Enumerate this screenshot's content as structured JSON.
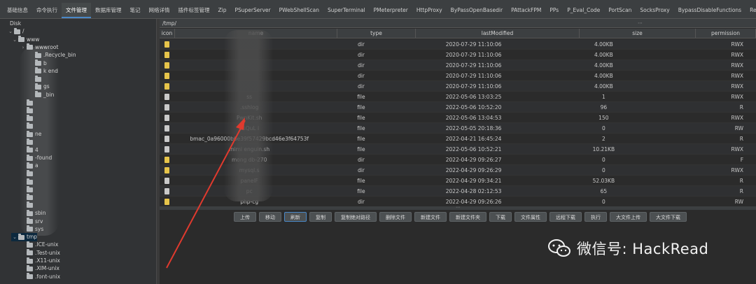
{
  "tabs": [
    "基础信息",
    "命令执行",
    "文件管理",
    "数据库管理",
    "笔记",
    "网络详情",
    "插件标签管理",
    "Zip",
    "PSuperServer",
    "PWebShellScan",
    "SuperTerminal",
    "PMeterpreter",
    "HttpProxy",
    "ByPassOpenBasedir",
    "PAttackFPM",
    "PPs",
    "P_Eval_Code",
    "PortScan",
    "SocksProxy",
    "BypassDisableFunctions",
    "ReaR"
  ],
  "active_tab_index": 2,
  "tree": {
    "rows": [
      {
        "label": "Disk",
        "caret": "",
        "folder": false
      },
      {
        "label": "/",
        "caret": "⌄",
        "folder": true
      },
      {
        "label": "www",
        "caret": "⌄",
        "folder": true
      },
      {
        "label": "wwwroot",
        "caret": "›",
        "folder": true
      },
      {
        "label": ".Recycle_bin",
        "caret": "",
        "folder": true
      },
      {
        "label": "b",
        "caret": "",
        "folder": true
      },
      {
        "label": "k      end",
        "caret": "",
        "folder": true
      },
      {
        "label": "",
        "caret": "",
        "folder": true
      },
      {
        "label": "      gs",
        "caret": "",
        "folder": true
      },
      {
        "label": "       _bin",
        "caret": "",
        "folder": true
      },
      {
        "label": "",
        "caret": "",
        "folder": true
      },
      {
        "label": "",
        "caret": "",
        "folder": true
      },
      {
        "label": "",
        "caret": "",
        "folder": true
      },
      {
        "label": "",
        "caret": "",
        "folder": true
      },
      {
        "label": "      ne",
        "caret": "",
        "folder": true
      },
      {
        "label": "",
        "caret": "",
        "folder": true
      },
      {
        "label": "      4",
        "caret": "",
        "folder": true
      },
      {
        "label": "      -found",
        "caret": "",
        "folder": true
      },
      {
        "label": "      a",
        "caret": "",
        "folder": true
      },
      {
        "label": "",
        "caret": "",
        "folder": true
      },
      {
        "label": "",
        "caret": "",
        "folder": true
      },
      {
        "label": "",
        "caret": "",
        "folder": true
      },
      {
        "label": "",
        "caret": "",
        "folder": true
      },
      {
        "label": "",
        "caret": "",
        "folder": true
      },
      {
        "label": "sbin",
        "caret": "",
        "folder": true
      },
      {
        "label": "srv",
        "caret": "",
        "folder": true
      },
      {
        "label": "sys",
        "caret": "",
        "folder": true
      },
      {
        "label": "tmp",
        "caret": "⌄",
        "folder": true
      },
      {
        "label": ".ICE-unix",
        "caret": "",
        "folder": true
      },
      {
        "label": ".Test-unix",
        "caret": "",
        "folder": true
      },
      {
        "label": ".X11-unix",
        "caret": "",
        "folder": true
      },
      {
        "label": ".XIM-unix",
        "caret": "",
        "folder": true
      },
      {
        "label": ".font-unix",
        "caret": "",
        "folder": true
      }
    ]
  },
  "path": "/tmp/",
  "columns": [
    "icon",
    "name",
    "type",
    "lastModified",
    "size",
    "permission"
  ],
  "files": [
    {
      "kind": "dir",
      "name": "",
      "type": "dir",
      "lastModified": "2020-07-29 11:10:06",
      "size": "4.00KB",
      "permission": "RWX"
    },
    {
      "kind": "dir",
      "name": "",
      "type": "dir",
      "lastModified": "2020-07-29 11:10:06",
      "size": "4.00KB",
      "permission": "RWX"
    },
    {
      "kind": "dir",
      "name": "",
      "type": "dir",
      "lastModified": "2020-07-29 11:10:06",
      "size": "4.00KB",
      "permission": "RWX"
    },
    {
      "kind": "dir",
      "name": "",
      "type": "dir",
      "lastModified": "2020-07-29 11:10:06",
      "size": "4.00KB",
      "permission": "RWX"
    },
    {
      "kind": "dir",
      "name": "",
      "type": "dir",
      "lastModified": "2020-07-29 11:10:06",
      "size": "4.00KB",
      "permission": "RWX"
    },
    {
      "kind": "file",
      "name": "          ss",
      "type": "file",
      "lastModified": "2022-05-06 13:03:25",
      "size": "1",
      "permission": "RWX"
    },
    {
      "kind": "file",
      "name": ".sshlog",
      "type": "file",
      "lastModified": "2022-05-06 10:52:20",
      "size": "96",
      "permission": "R"
    },
    {
      "kind": "file",
      "name": "PwnKit.sh",
      "type": "file",
      "lastModified": "2022-05-06 13:04:53",
      "size": "150",
      "permission": "RWX"
    },
    {
      "kind": "file",
      "name": "asQuL  i",
      "type": "file",
      "lastModified": "2022-05-05 20:18:36",
      "size": "0",
      "permission": "RW"
    },
    {
      "kind": "file",
      "name": "bmac_0a96000b6e39f57429bcd46e3f64753f",
      "type": "file",
      "lastModified": "2022-04-21 16:45:24",
      "size": "2",
      "permission": "R"
    },
    {
      "kind": "file",
      "name": "mimi  enguin.sh",
      "type": "file",
      "lastModified": "2022-05-06 10:52:21",
      "size": "10.21KB",
      "permission": "RWX"
    },
    {
      "kind": "dir",
      "name": "mong  db-270",
      "type": "dir",
      "lastModified": "2022-04-29 09:26:27",
      "size": "0",
      "permission": "F"
    },
    {
      "kind": "dir",
      "name": "mysql.s",
      "type": "dir",
      "lastModified": "2022-04-29 09:26:29",
      "size": "0",
      "permission": "RWX"
    },
    {
      "kind": "file",
      "name": "panelF",
      "type": "file",
      "lastModified": "2022-04-29 09:34:21",
      "size": "52.03KB",
      "permission": "R"
    },
    {
      "kind": "file",
      "name": "pc",
      "type": "file",
      "lastModified": "2022-04-28 02:12:53",
      "size": "65",
      "permission": "R"
    },
    {
      "kind": "dir",
      "name": "php-cg",
      "type": "dir",
      "lastModified": "2022-04-29 09:26:26",
      "size": "0",
      "permission": "RW"
    }
  ],
  "buttons": [
    "上传",
    "移动",
    "刷新",
    "复制",
    "复制绝对路径",
    "删除文件",
    "新建文件",
    "新建文件夹",
    "下载",
    "文件属性",
    "远程下载",
    "执行",
    "大文件上传",
    "大文件下载"
  ],
  "focused_button_index": 2,
  "watermark": {
    "text": "微信号: HackRead"
  },
  "colors": {
    "accent": "#4a88c7",
    "annotation": "#e03a2e",
    "folder": "#e6c44a"
  }
}
